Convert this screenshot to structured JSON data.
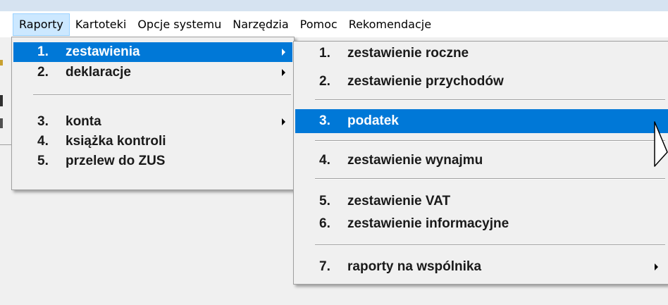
{
  "menubar": {
    "items": [
      {
        "label": "Raporty",
        "active": true
      },
      {
        "label": "Kartoteki"
      },
      {
        "label": "Opcje systemu"
      },
      {
        "label": "Narzędzia"
      },
      {
        "label": "Pomoc"
      },
      {
        "label": "Rekomendacje"
      }
    ]
  },
  "menu_raporty": {
    "items": [
      {
        "num": "1.",
        "label": "zestawienia",
        "submenu": true,
        "highlighted": true
      },
      {
        "num": "2.",
        "label": "deklaracje",
        "submenu": true
      },
      {
        "num": "3.",
        "label": "konta",
        "submenu": true
      },
      {
        "num": "4.",
        "label": "książka kontroli"
      },
      {
        "num": "5.",
        "label": "przelew do ZUS"
      }
    ]
  },
  "menu_zestawienia": {
    "items": [
      {
        "num": "1.",
        "label": "zestawienie roczne"
      },
      {
        "num": "2.",
        "label": "zestawienie przychodów"
      },
      {
        "num": "3.",
        "label": "podatek",
        "highlighted": true
      },
      {
        "num": "4.",
        "label": "zestawienie wynajmu"
      },
      {
        "num": "5.",
        "label": "zestawienie VAT"
      },
      {
        "num": "6.",
        "label": "zestawienie informacyjne"
      },
      {
        "num": "7.",
        "label": "raporty na wspólnika",
        "submenu": true
      }
    ]
  },
  "colors": {
    "highlight": "#0078d7",
    "menubar_active": "#cce8ff",
    "menu_bg": "#f0f0f0"
  },
  "icons": {
    "submenu": "chevron-right-icon",
    "pointer": "mouse-cursor-icon"
  }
}
